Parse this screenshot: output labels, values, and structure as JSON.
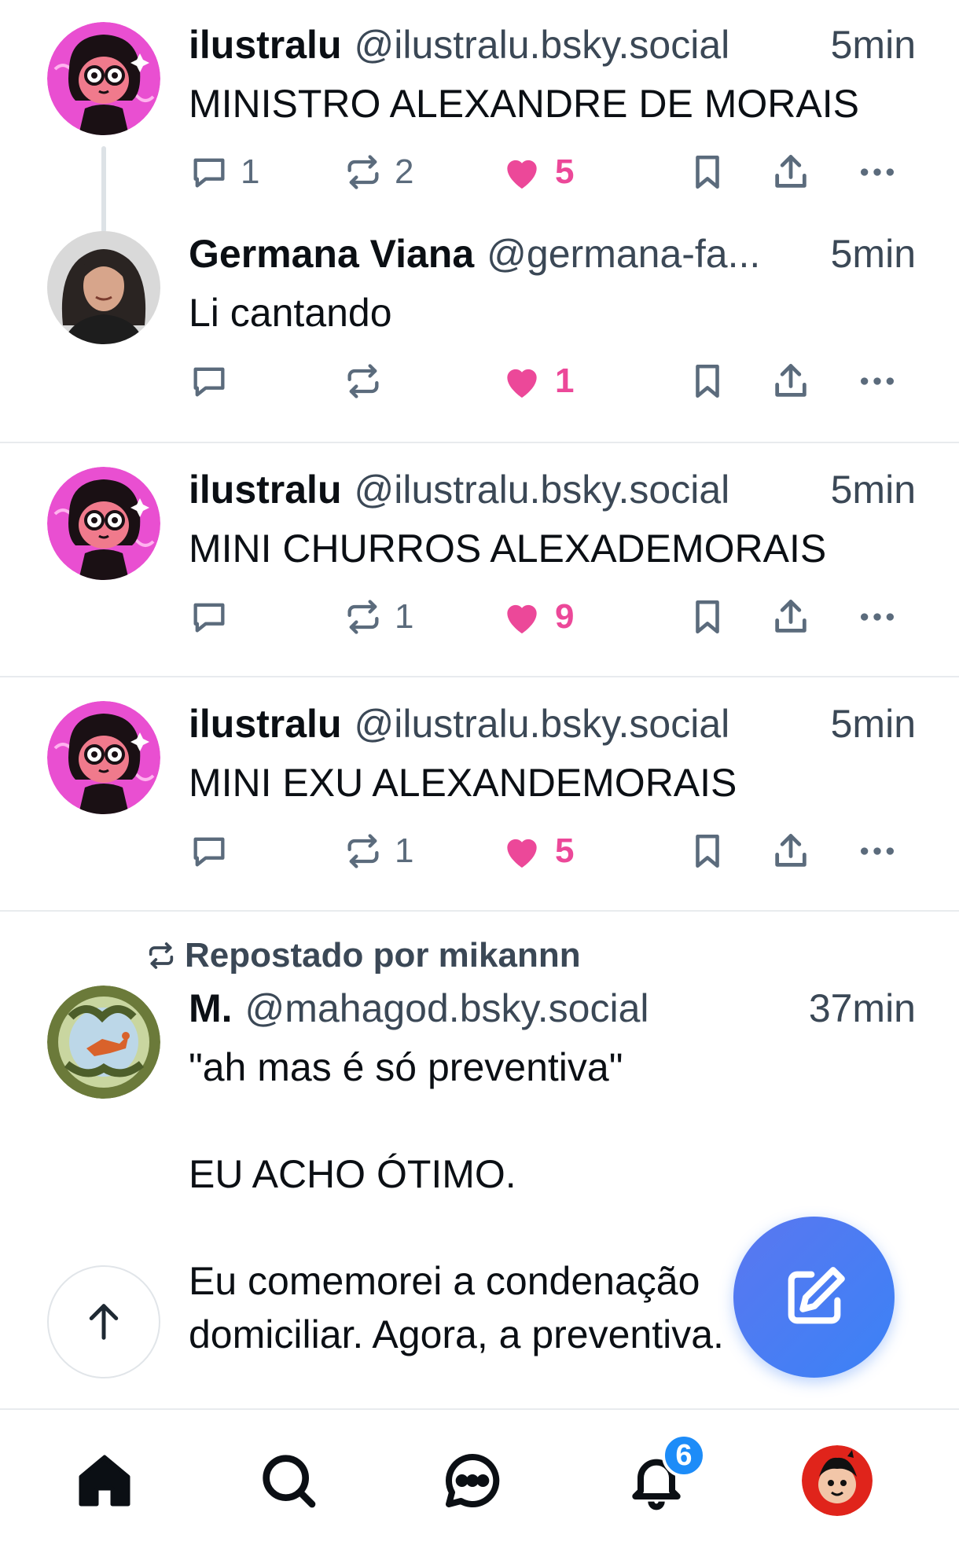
{
  "feed": {
    "posts": [
      {
        "author": "ilustralu",
        "handle": "@ilustralu.bsky.social",
        "time": "5min",
        "text": "MINISTRO ALEXANDRE DE MORAIS",
        "replies": "1",
        "reposts": "2",
        "likes": "5"
      },
      {
        "author": "Germana Viana",
        "handle": "@germana-fa...",
        "time": "5min",
        "text": "Li cantando",
        "replies": "",
        "reposts": "",
        "likes": "1"
      },
      {
        "author": "ilustralu",
        "handle": "@ilustralu.bsky.social",
        "time": "5min",
        "text": "MINI CHURROS ALEXADEMORAIS",
        "replies": "",
        "reposts": "1",
        "likes": "9"
      },
      {
        "author": "ilustralu",
        "handle": "@ilustralu.bsky.social",
        "time": "5min",
        "text": "MINI EXU ALEXANDEMORAIS",
        "replies": "",
        "reposts": "1",
        "likes": "5"
      },
      {
        "repost_label": "Repostado por mikannn",
        "author": "M.",
        "handle": "@mahagod.bsky.social",
        "time": "37min",
        "text": "\"ah mas é só preventiva\"\n\nEU ACHO ÓTIMO.\n\nEu comemorei a condenação\ndomiciliar. Agora, a preventiva."
      }
    ]
  },
  "tabbar": {
    "notification_count": "6"
  },
  "icons": {
    "reply": "comment-icon",
    "repost": "repost-icon",
    "like": "heart-icon",
    "bookmark": "bookmark-icon",
    "share": "share-icon",
    "more": "more-icon",
    "compose": "compose-icon",
    "scroll_top": "arrow-up-icon",
    "home": "home-icon",
    "search": "search-icon",
    "chat": "chat-icon",
    "notifications": "bell-icon"
  },
  "colors": {
    "like": "#ec4899",
    "accent": "#3b82f6",
    "muted": "#5b6b7c"
  }
}
